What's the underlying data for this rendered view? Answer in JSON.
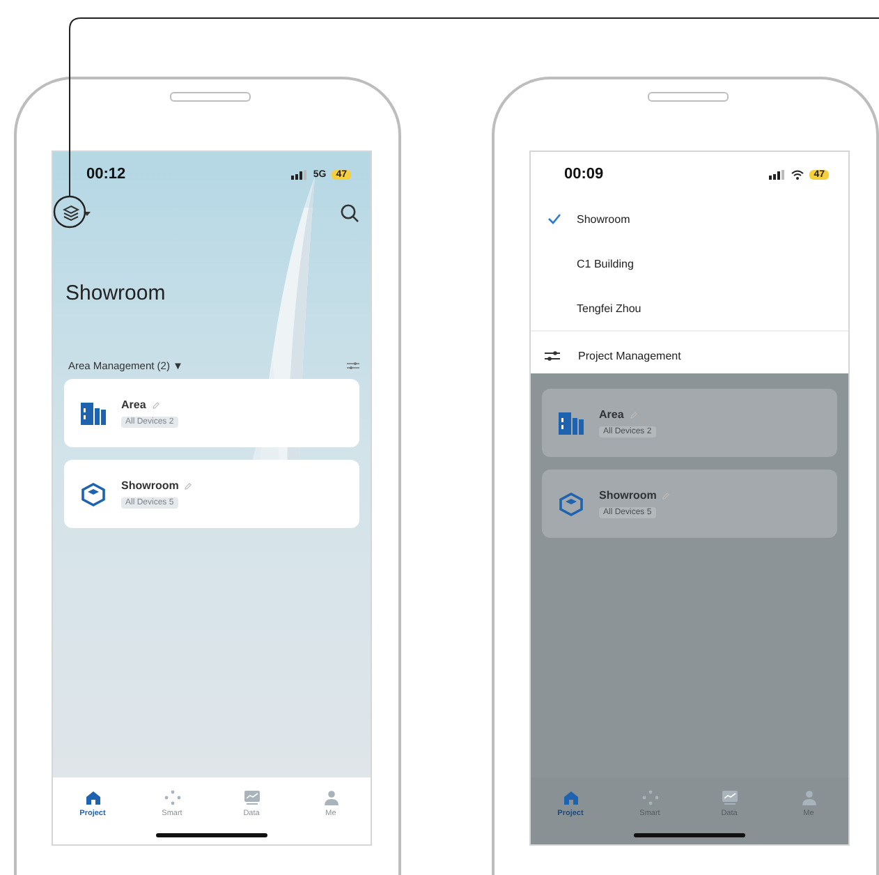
{
  "screens": [
    {
      "status": {
        "time": "00:12",
        "network": "5G",
        "battery": "47"
      },
      "title": "Showroom",
      "section": "Area Management (2) ▼",
      "cards": [
        {
          "name": "Area",
          "badge": "All Devices 2"
        },
        {
          "name": "Showroom",
          "badge": "All Devices 5"
        }
      ],
      "nav": [
        {
          "label": "Project",
          "selected": true
        },
        {
          "label": "Smart",
          "selected": false
        },
        {
          "label": "Data",
          "selected": false
        },
        {
          "label": "Me",
          "selected": false
        }
      ]
    },
    {
      "status": {
        "time": "00:09",
        "battery": "47"
      },
      "menu": {
        "items": [
          {
            "label": "Showroom",
            "selected": true
          },
          {
            "label": "C1 Building",
            "selected": false
          },
          {
            "label": "Tengfei Zhou",
            "selected": false
          }
        ],
        "footer": "Project Management"
      },
      "cards": [
        {
          "name": "Area",
          "badge": "All Devices 2"
        },
        {
          "name": "Showroom",
          "badge": "All Devices 5"
        }
      ],
      "nav": [
        {
          "label": "Project",
          "selected": true
        },
        {
          "label": "Smart",
          "selected": false
        },
        {
          "label": "Data",
          "selected": false
        },
        {
          "label": "Me",
          "selected": false
        }
      ]
    }
  ]
}
